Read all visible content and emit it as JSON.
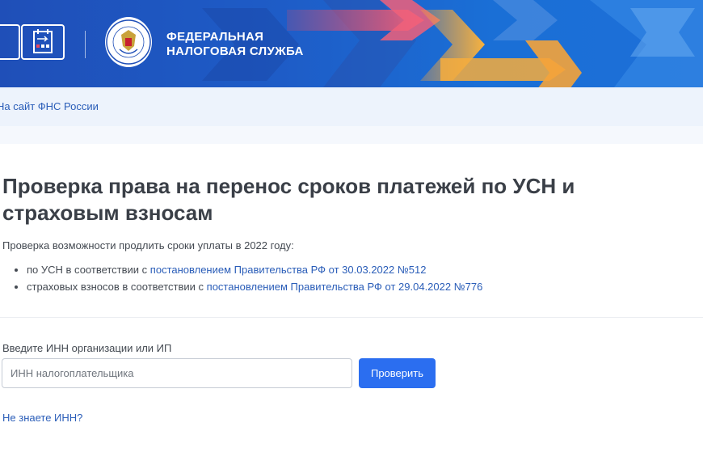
{
  "header": {
    "brand_line1": "ФЕДЕРАЛЬНАЯ",
    "brand_line2": "НАЛОГОВАЯ СЛУЖБА",
    "icons": [
      "search-icon",
      "calendar-icon",
      "fns-emblem"
    ]
  },
  "breadcrumb": {
    "link": "На сайт ФНС России"
  },
  "main": {
    "title": "Проверка права на перенос сроков платежей по УСН и страховым взносам",
    "description": "Проверка возможности продлить сроки уплаты в 2022 году:",
    "items": [
      {
        "prefix": "по УСН в соответствии с ",
        "link": "постановлением Правительства РФ от 30.03.2022 №512"
      },
      {
        "prefix": "страховых взносов в соответствии с ",
        "link": "постановлением Правительства РФ от 29.04.2022 №776"
      }
    ]
  },
  "form": {
    "label": "Введите ИНН организации или ИП",
    "input_value": "",
    "input_placeholder": "ИНН налогоплательщика",
    "submit_label": "Проверить",
    "help_link": "Не знаете ИНН?"
  },
  "colors": {
    "header_blue": "#1f5cc5",
    "link_blue": "#2a5db8",
    "button_blue": "#2b6ef0",
    "breadcrumb_bg": "#edf3fc"
  }
}
